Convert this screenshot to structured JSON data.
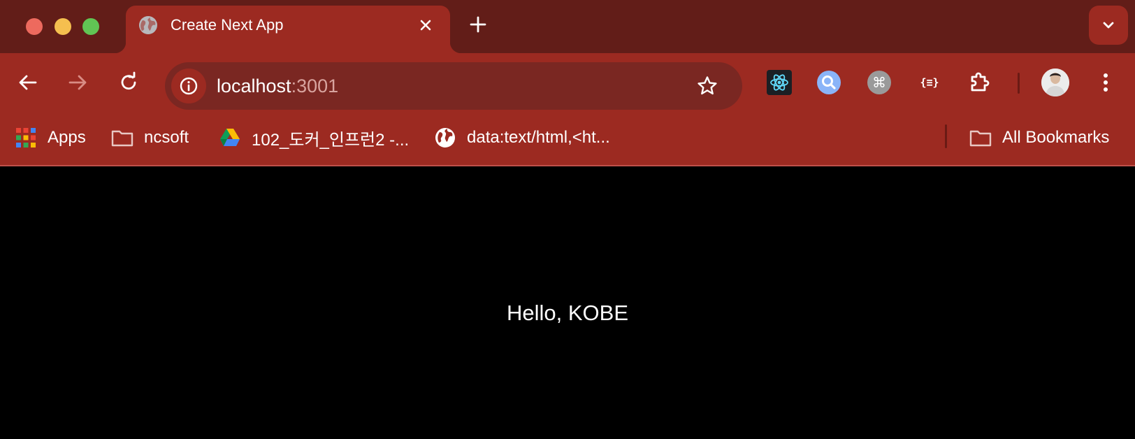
{
  "colors": {
    "tabstrip": "#621d18",
    "toolbar": "#9c2a21",
    "omnibox": "#7a2722",
    "page_background": "#000000",
    "page_text": "#ffffff"
  },
  "tab": {
    "title": "Create Next App",
    "favicon": "globe-icon"
  },
  "omnibox": {
    "host": "localhost",
    "port": ":3001"
  },
  "extensions": [
    {
      "name": "react-devtools-icon"
    },
    {
      "name": "search-extension-icon"
    },
    {
      "name": "command-icon"
    },
    {
      "name": "json-viewer-icon",
      "label": "{≡}"
    },
    {
      "name": "extensions-puzzle-icon"
    }
  ],
  "bookmarks": {
    "items": [
      {
        "label": "Apps",
        "icon": "apps-grid-icon"
      },
      {
        "label": "ncsoft",
        "icon": "folder-icon"
      },
      {
        "label": "102_도커_인프런2 -...",
        "icon": "google-drive-icon"
      },
      {
        "label": "data:text/html,<ht...",
        "icon": "globe-icon"
      }
    ],
    "all_bookmarks": "All Bookmarks"
  },
  "page": {
    "greeting": "Hello, KOBE"
  }
}
